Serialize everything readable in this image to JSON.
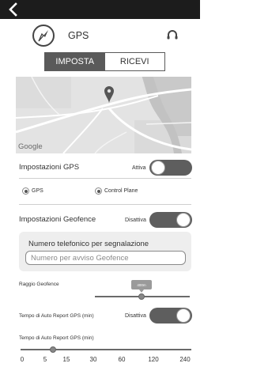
{
  "header": {
    "title": "GPS"
  },
  "tabs": {
    "set_label": "IMPOSTA",
    "receive_label": "RICEVI"
  },
  "map": {
    "logo_text": "Google"
  },
  "gps_settings": {
    "label": "Impostazioni GPS",
    "toggle_label": "Attiva",
    "toggle_state": "off",
    "radio_gps_label": "GPS",
    "radio_cp_label": "Control Plane"
  },
  "geofence": {
    "label": "Impostazioni Geofence",
    "toggle_label": "Disattiva",
    "toggle_state": "on",
    "phone_title": "Numero telefonico per segnalazione",
    "phone_placeholder": "Numero per avviso Geofence",
    "radius_label": "Raggio Geofence",
    "radius_value": "400m"
  },
  "auto_report": {
    "label": "Tempo di Auto Report GPS (min)",
    "toggle_label": "Disattiva",
    "toggle_state": "on",
    "slider_label": "Tempo di Auto Report GPS (min)",
    "ticks": [
      "0",
      "5",
      "15",
      "30",
      "60",
      "120",
      "240"
    ],
    "selected_index": 1
  },
  "colors": {
    "topbar": "#1c1c1c",
    "accent": "#5a5a5a",
    "toggle": "#5e5e5e"
  }
}
